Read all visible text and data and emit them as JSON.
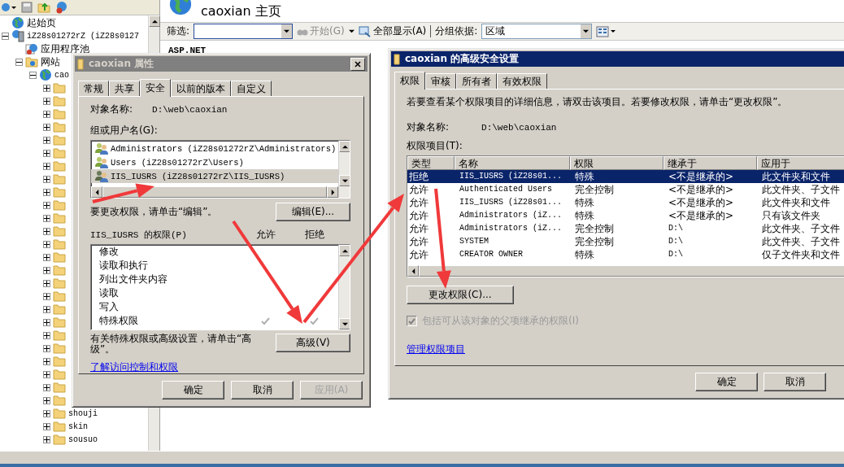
{
  "tree": {
    "items": [
      {
        "kind": "start-page",
        "name": "起始页"
      },
      {
        "kind": "server",
        "name": "iZ28s01272rZ (iZ28s0127",
        "expanded": true,
        "children": [
          {
            "kind": "app-pool",
            "name": "应用程序池"
          },
          {
            "kind": "sites",
            "name": "网站",
            "expanded": true,
            "children": [
              {
                "kind": "site",
                "name": "cao",
                "expanded": true,
                "children": [
                  {
                    "kind": "folder",
                    "expanded": false
                  },
                  {
                    "kind": "folder",
                    "expanded": false
                  },
                  {
                    "kind": "folder",
                    "expanded": false
                  },
                  {
                    "kind": "folder",
                    "expanded": false
                  },
                  {
                    "kind": "folder",
                    "expanded": false
                  },
                  {
                    "kind": "folder",
                    "expanded": false
                  },
                  {
                    "kind": "folder",
                    "expanded": false
                  },
                  {
                    "kind": "folder",
                    "expanded": false
                  },
                  {
                    "kind": "folder",
                    "expanded": false
                  },
                  {
                    "kind": "folder",
                    "expanded": false
                  },
                  {
                    "kind": "folder",
                    "expanded": false
                  },
                  {
                    "kind": "folder",
                    "expanded": false
                  },
                  {
                    "kind": "folder",
                    "expanded": false
                  },
                  {
                    "kind": "folder",
                    "expanded": false
                  },
                  {
                    "kind": "folder",
                    "expanded": false
                  },
                  {
                    "kind": "folder",
                    "expanded": false
                  },
                  {
                    "kind": "folder",
                    "expanded": false
                  },
                  {
                    "kind": "folder",
                    "expanded": false
                  },
                  {
                    "kind": "folder",
                    "expanded": false
                  },
                  {
                    "kind": "folder",
                    "expanded": false
                  },
                  {
                    "kind": "folder",
                    "expanded": false
                  },
                  {
                    "kind": "folder",
                    "expanded": false
                  },
                  {
                    "kind": "folder",
                    "expanded": false
                  },
                  {
                    "kind": "folder",
                    "expanded": false
                  },
                  {
                    "kind": "folder",
                    "expanded": false
                  },
                  {
                    "kind": "folder",
                    "name": "shouji",
                    "expanded": false
                  },
                  {
                    "kind": "folder",
                    "name": "skin",
                    "expanded": false
                  },
                  {
                    "kind": "folder",
                    "name": "sousuo",
                    "expanded": false
                  }
                ]
              }
            ]
          }
        ]
      }
    ]
  },
  "main": {
    "page_title": "caoxian 主页",
    "toolbar": {
      "filter_label": "筛选:",
      "start_button": {
        "label": "开始(G)",
        "disabled": true
      },
      "show_all_button": "全部显示(A)",
      "group_label": "分组依据:",
      "group_value": "区域"
    },
    "section_heading": "ASP.NET"
  },
  "properties_dialog": {
    "title": "caoxian 属性",
    "active": false,
    "tabs": [
      {
        "label": "常规",
        "selected": false
      },
      {
        "label": "共享",
        "selected": false
      },
      {
        "label": "安全",
        "selected": true
      },
      {
        "label": "以前的版本",
        "selected": false
      },
      {
        "label": "自定义",
        "selected": false
      }
    ],
    "object_label": "对象名称:",
    "object_value": "D:\\web\\caoxian",
    "groups_label": "组或用户名(G):",
    "groups": [
      {
        "name": "Administrators (iZ28s01272rZ\\Administrators)",
        "selected": false
      },
      {
        "name": "Users (iZ28s01272rZ\\Users)",
        "selected": false
      },
      {
        "name": "IIS_IUSRS (iZ28s01272rZ\\IIS_IUSRS)",
        "selected": true
      }
    ],
    "edit_hint": "要更改权限，请单击“编辑”。",
    "edit_button": "编辑(E)...",
    "permissions_label": "IIS_IUSRS 的权限(P)",
    "allow_label": "允许",
    "deny_label": "拒绝",
    "permissions": [
      {
        "name": "修改",
        "allow": false,
        "deny": false
      },
      {
        "name": "读取和执行",
        "allow": false,
        "deny": false
      },
      {
        "name": "列出文件夹内容",
        "allow": false,
        "deny": false
      },
      {
        "name": "读取",
        "allow": false,
        "deny": false
      },
      {
        "name": "写入",
        "allow": false,
        "deny": false
      },
      {
        "name": "特殊权限",
        "allow": true,
        "deny": true
      }
    ],
    "advanced_hint": "有关特殊权限或高级设置，请单击“高级”。",
    "advanced_button": "高级(V)",
    "link": "了解访问控制和权限",
    "buttons": [
      {
        "label": "确定",
        "disabled": false
      },
      {
        "label": "取消",
        "disabled": false
      },
      {
        "label": "应用(A)",
        "disabled": true
      }
    ]
  },
  "advanced_dialog": {
    "title": "caoxian 的高级安全设置",
    "active": true,
    "tabs": [
      {
        "label": "权限",
        "selected": true
      },
      {
        "label": "审核",
        "selected": false
      },
      {
        "label": "所有者",
        "selected": false
      },
      {
        "label": "有效权限",
        "selected": false
      }
    ],
    "hint": "若要查看某个权限项目的详细信息，请双击该项目。若要修改权限，请单击“更改权限”。",
    "object_label": "对象名称:",
    "object_value": "D:\\web\\caoxian",
    "entries_label": "权限项目(T):",
    "columns": [
      "类型",
      "名称",
      "权限",
      "继承于",
      "应用于"
    ],
    "rows": [
      {
        "cells": [
          "拒绝",
          "IIS_IUSRS (iZ28s01...",
          "特殊",
          "<不是继承的>",
          "此文件夹和文件"
        ],
        "selected": true
      },
      {
        "cells": [
          "允许",
          "Authenticated Users",
          "完全控制",
          "<不是继承的>",
          "此文件夹、子文件"
        ],
        "selected": false
      },
      {
        "cells": [
          "允许",
          "IIS_IUSRS (iZ28s01...",
          "特殊",
          "<不是继承的>",
          "此文件夹和文件"
        ],
        "selected": false
      },
      {
        "cells": [
          "允许",
          "Administrators (iZ...",
          "特殊",
          "<不是继承的>",
          "只有该文件夹"
        ],
        "selected": false
      },
      {
        "cells": [
          "允许",
          "Administrators (iZ...",
          "完全控制",
          "D:\\",
          "此文件夹、子文件"
        ],
        "selected": false
      },
      {
        "cells": [
          "允许",
          "SYSTEM",
          "完全控制",
          "D:\\",
          "此文件夹、子文件"
        ],
        "selected": false
      },
      {
        "cells": [
          "允许",
          "CREATOR OWNER",
          "特殊",
          "D:\\",
          "仅子文件夹和文件"
        ],
        "selected": false
      }
    ],
    "change_button": "更改权限(C)...",
    "inherit_checkbox": {
      "label": "包括可从该对象的父项继承的权限(I)",
      "checked": true,
      "disabled": true
    },
    "link": "管理权限项目",
    "buttons": [
      {
        "label": "确定",
        "disabled": false
      },
      {
        "label": "取消",
        "disabled": false
      }
    ]
  }
}
